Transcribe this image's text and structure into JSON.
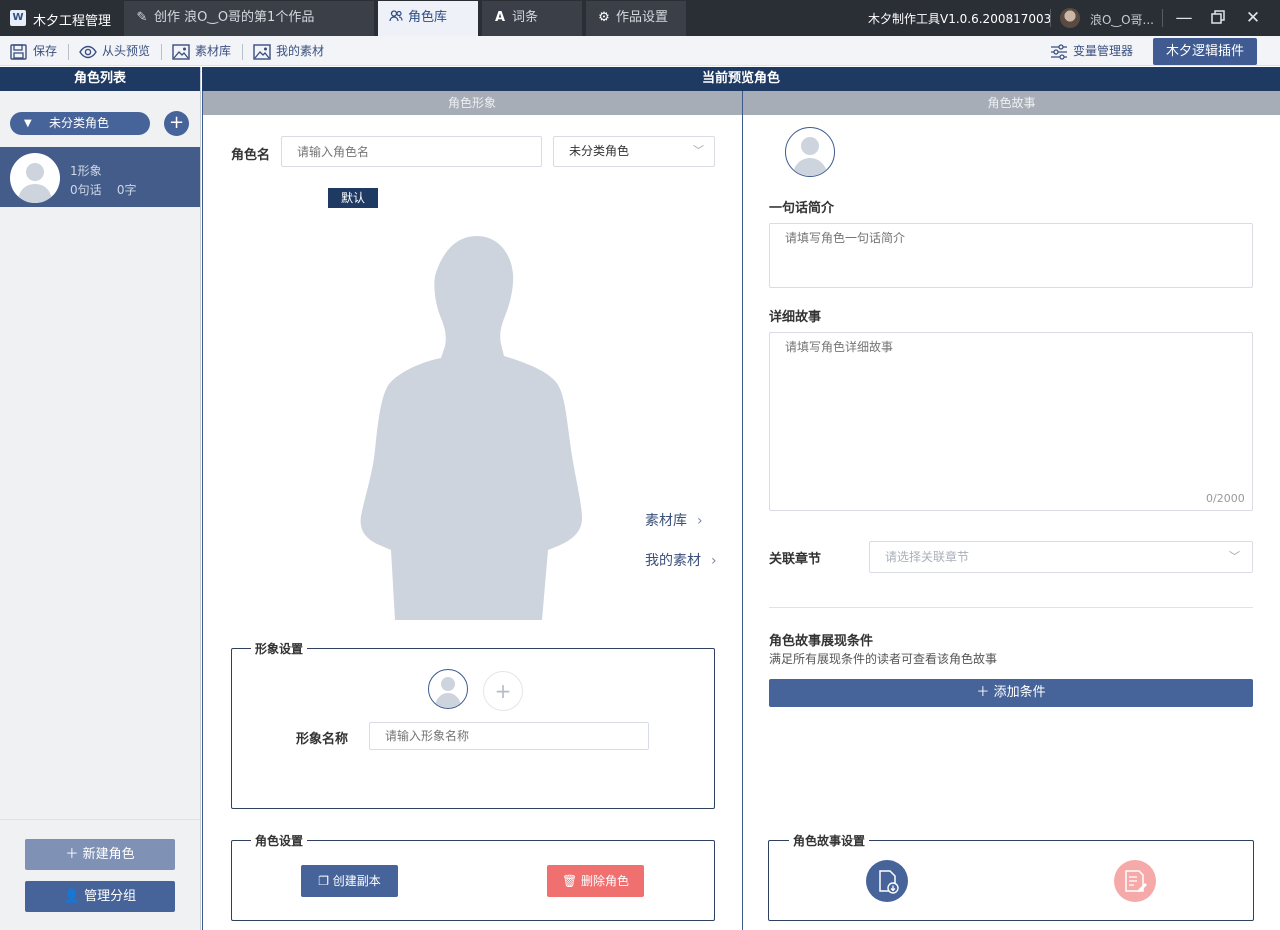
{
  "titlebar": {
    "app_title": "木夕工程管理",
    "tabs": [
      {
        "label": "创作 浪O‿O哥的第1个作品",
        "icon": "pen-icon"
      },
      {
        "label": "角色库",
        "icon": "users-icon",
        "active": true
      },
      {
        "label": "词条",
        "icon": "text-icon"
      },
      {
        "label": "作品设置",
        "icon": "gear-icon"
      }
    ],
    "version": "木夕制作工具V1.0.6.200817003",
    "user_name": "浪O‿O哥..."
  },
  "toolbar": {
    "save": "保存",
    "preview_from_start": "从头预览",
    "asset_library": "素材库",
    "my_assets": "我的素材",
    "variable_manager": "变量管理器",
    "plugin": "木夕逻辑插件"
  },
  "left_panel": {
    "title": "角色列表",
    "group_label": "未分类角色",
    "role_item": {
      "images": "1形象",
      "lines": "0句话",
      "words": "0字"
    },
    "new_role": "新建角色",
    "manage_groups": "管理分组"
  },
  "main": {
    "title": "当前预览角色",
    "appearance_header": "角色形象",
    "story_header": "角色故事",
    "role_name_label": "角色名",
    "role_name_placeholder": "请输入角色名",
    "group_select_value": "未分类角色",
    "default_badge": "默认",
    "asset_link": "素材库",
    "my_asset_link": "我的素材",
    "image_settings": {
      "legend": "形象设置",
      "image_name_label": "形象名称",
      "image_name_placeholder": "请输入形象名称"
    },
    "role_settings": {
      "legend": "角色设置",
      "copy_button": "创建副本",
      "delete_button": "删除角色"
    },
    "story": {
      "brief_label": "一句话简介",
      "brief_placeholder": "请填写角色一句话简介",
      "detail_label": "详细故事",
      "detail_placeholder": "请填写角色详细故事",
      "detail_counter": "0/2000",
      "chapter_label": "关联章节",
      "chapter_placeholder": "请选择关联章节",
      "conditions_title": "角色故事展现条件",
      "conditions_hint": "满足所有展现条件的读者可查看该角色故事",
      "add_condition": "添加条件",
      "story_settings_legend": "角色故事设置"
    }
  },
  "colors": {
    "title_bar": "#2a2e35",
    "navy": "#1f3a62",
    "accent": "#46639a",
    "danger": "#f07070",
    "silhouette": "#cdd4dd"
  }
}
